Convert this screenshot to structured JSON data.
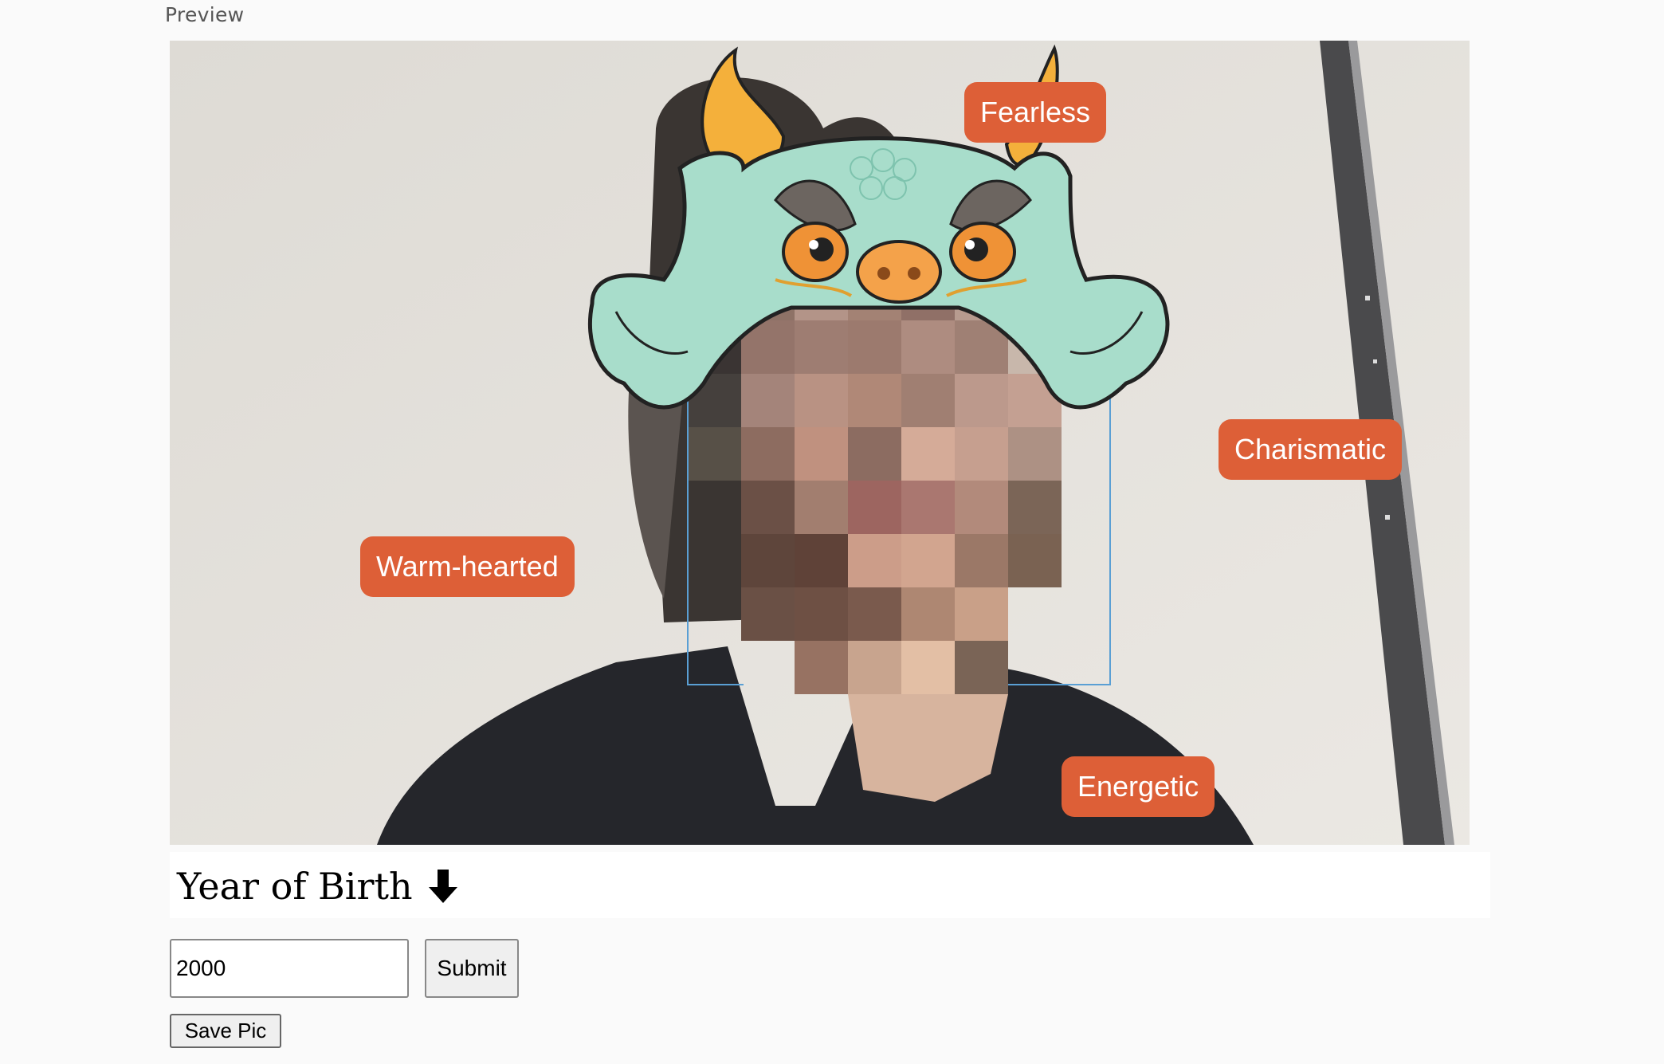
{
  "preview": {
    "label": "Preview"
  },
  "camera": {
    "tags": {
      "fearless": "Fearless",
      "charismatic": "Charismatic",
      "warm_hearted": "Warm-hearted",
      "energetic": "Energetic"
    },
    "tag_color": "#dd5f37",
    "overlay": "dragon-hat",
    "face": "pixelated"
  },
  "year_of_birth": {
    "title": "Year of Birth",
    "icon": "arrow-down-icon",
    "input_value": "2000",
    "submit_label": "Submit"
  },
  "save": {
    "label": "Save Pic"
  }
}
